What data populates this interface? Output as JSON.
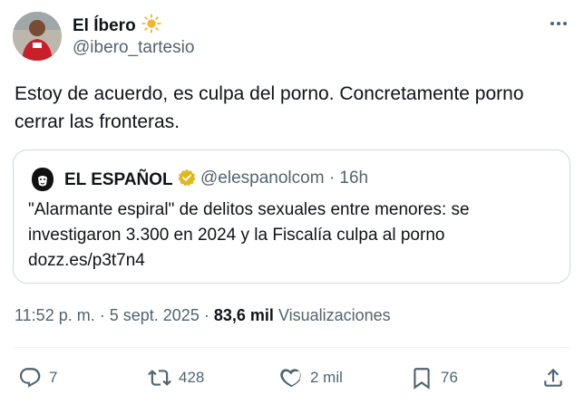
{
  "tweet": {
    "display_name": "El Íbero",
    "name_emoji": "☀️",
    "handle": "@ibero_tartesio",
    "text": "Estoy de acuerdo, es culpa del porno. Concretamente porno cerrar las fronteras."
  },
  "quoted": {
    "name": "EL ESPAÑOL",
    "handle": "@elespanolcom",
    "separator": "·",
    "time": "16h",
    "line1": "\"Alarmante espiral\" de delitos sexuales entre menores: se",
    "line2": "investigaron 3.300 en 2024 y la Fiscalía culpa al porno",
    "link": "dozz.es/p3t7n4"
  },
  "meta": {
    "time": "11:52 p. m.",
    "sep": "·",
    "date": "5 sept. 2025",
    "sep2": "·",
    "views_count": "83,6 mil",
    "views_label": "Visualizaciones"
  },
  "actions": {
    "reply_count": "7",
    "retweet_count": "428",
    "like_count": "2 mil",
    "bookmark_count": "76"
  },
  "colors": {
    "text": "#0f1419",
    "secondary": "#536471",
    "border": "#cfd9de",
    "verified_gold": "#e2b719"
  }
}
